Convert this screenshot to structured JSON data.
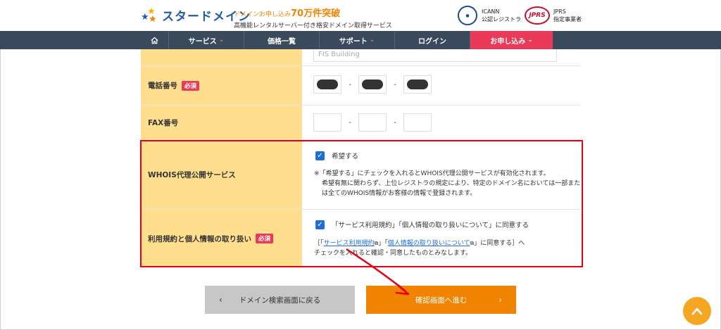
{
  "header": {
    "logo_text": "スタードメイン",
    "tagline_prefix": "ドメインお申し込み",
    "tagline_count": "70万件突破",
    "tagline_sub": "高機能レンタルサーバー付き格安ドメイン取得サービス",
    "icann_line1": "ICANN",
    "icann_line2": "公認レジストラ",
    "jprs_logo": "JPRS",
    "jprs_line1": "JPRS",
    "jprs_line2": "指定事業者"
  },
  "nav": {
    "home_icon": "home-icon",
    "items": [
      "サービス",
      "価格一覧",
      "サポート",
      "ログイン",
      "お申し込み"
    ]
  },
  "form": {
    "building_placeholder": "FIS Building",
    "phone_label": "電話番号",
    "required_badge": "必須",
    "fax_label": "FAX番号",
    "whois_label": "WHOIS代理公開サービス",
    "whois_checkbox_label": "希望する",
    "whois_note_1": "※「希望する」にチェックを入れるとWHOIS代理公開サービスが有効化されます。",
    "whois_note_2": "希望有無に関わらず、上位レジストラの規定により、特定のドメイン名においては一部または全てのWHOIS情報がお客様の情報で登録されます。",
    "terms_label": "利用規約と個人情報の取り扱い",
    "terms_checkbox_label": "「サービス利用規約」「個人情報の取り扱いについて」に同意する",
    "terms_note_open": "［「",
    "terms_link_1": "サービス利用規約",
    "terms_note_mid": "」「",
    "terms_link_2": "個人情報の取り扱いについて",
    "terms_note_close": "」に同意する］へ",
    "terms_note_2": "チェックを入れると確認・同意したものとみなします。"
  },
  "buttons": {
    "back": "ドメイン検索画面に戻る",
    "next": "確認画面へ進む"
  },
  "colors": {
    "accent": "#f08300",
    "nav_bg": "#3a4a5c",
    "apply_bg": "#e93b59",
    "label_bg": "#ffdf8e",
    "highlight": "#e60012"
  }
}
